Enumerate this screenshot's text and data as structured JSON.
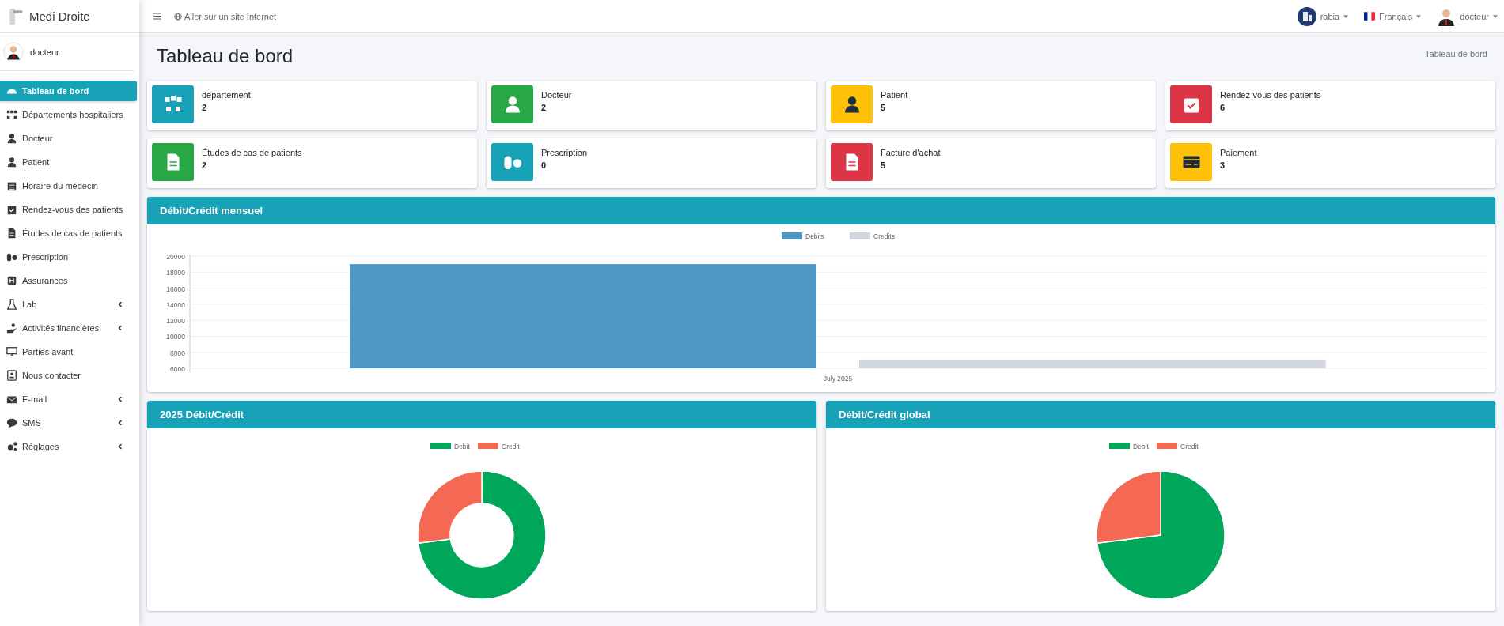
{
  "brand": {
    "name": "Medi Droite"
  },
  "sidebar": {
    "user": "docteur",
    "items": [
      {
        "label": "Tableau de bord",
        "selected": true,
        "kind": "link"
      },
      {
        "label": "Départements hospitaliers",
        "selected": false,
        "kind": "link"
      },
      {
        "label": "Docteur",
        "selected": false,
        "kind": "link"
      },
      {
        "label": "Patient",
        "selected": false,
        "kind": "link"
      },
      {
        "label": "Horaire du médecin",
        "selected": false,
        "kind": "link"
      },
      {
        "label": "Rendez-vous des patients",
        "selected": false,
        "kind": "link"
      },
      {
        "label": "Études de cas de patients",
        "selected": false,
        "kind": "link"
      },
      {
        "label": "Prescription",
        "selected": false,
        "kind": "link"
      },
      {
        "label": "Assurances",
        "selected": false,
        "kind": "link"
      },
      {
        "label": "Lab",
        "selected": false,
        "kind": "group"
      },
      {
        "label": "Activités financières",
        "selected": false,
        "kind": "group"
      },
      {
        "label": "Parties avant",
        "selected": false,
        "kind": "link"
      },
      {
        "label": "Nous contacter",
        "selected": false,
        "kind": "link"
      },
      {
        "label": "E-mail",
        "selected": false,
        "kind": "group"
      },
      {
        "label": "SMS",
        "selected": false,
        "kind": "group"
      },
      {
        "label": "Réglages",
        "selected": false,
        "kind": "group"
      }
    ]
  },
  "topbar": {
    "link": "Aller sur un site Internet",
    "hospital": "rabia",
    "language": "Français",
    "user": "docteur"
  },
  "page": {
    "title": "Tableau de bord",
    "breadcrumb": "Tableau de bord"
  },
  "stats": [
    {
      "label": "département",
      "value": "2",
      "color": "#17a2b8"
    },
    {
      "label": "Docteur",
      "value": "2",
      "color": "#28a745"
    },
    {
      "label": "Patient",
      "value": "5",
      "color": "#ffc107"
    },
    {
      "label": "Rendez-vous des patients",
      "value": "6",
      "color": "#dc3545"
    },
    {
      "label": "Études de cas de patients",
      "value": "2",
      "color": "#28a745"
    },
    {
      "label": "Prescription",
      "value": "0",
      "color": "#17a2b8"
    },
    {
      "label": "Facture d'achat",
      "value": "5",
      "color": "#dc3545"
    },
    {
      "label": "Paiement",
      "value": "3",
      "color": "#ffc107"
    }
  ],
  "monthly": {
    "title": "Débit/Crédit mensuel",
    "chart_data": {
      "type": "bar",
      "categories": [
        "July 2025"
      ],
      "series": [
        {
          "name": "Debits",
          "color": "#4f97c4",
          "values": [
            19000
          ]
        },
        {
          "name": "Credits",
          "color": "#d2d6de",
          "values": [
            7000
          ]
        }
      ],
      "grid": true,
      "legend": true,
      "ylim": [
        6000,
        20000
      ],
      "yticks": [
        6000,
        8000,
        10000,
        12000,
        14000,
        16000,
        18000,
        20000
      ]
    }
  },
  "yearly": {
    "title": "2025 Débit/Crédit",
    "chart_data": {
      "type": "donut",
      "categories": [
        "Debit",
        "Credit"
      ],
      "values": [
        73,
        27
      ],
      "colors": [
        "#00a65a",
        "#f56954"
      ],
      "legend": true
    }
  },
  "overall": {
    "title": "Débit/Crédit global",
    "chart_data": {
      "type": "pie",
      "categories": [
        "Debit",
        "Credit"
      ],
      "values": [
        73,
        27
      ],
      "colors": [
        "#00a65a",
        "#f56954"
      ],
      "legend": true
    }
  }
}
